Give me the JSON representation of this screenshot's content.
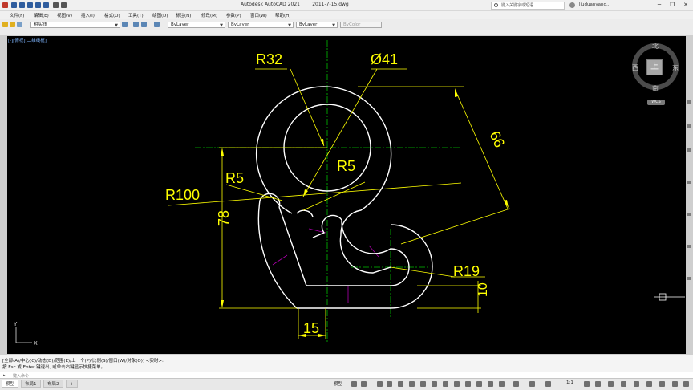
{
  "titlebar": {
    "app_title": "Autodesk AutoCAD 2021",
    "filename": "2011-7-15.dwg",
    "search_placeholder": "键入关键字或短语",
    "user": "liuduanyang...",
    "minimize": "─",
    "restore": "❐",
    "close": "✕"
  },
  "menu": [
    "文件(F)",
    "编辑(E)",
    "视图(V)",
    "插入(I)",
    "格式(O)",
    "工具(T)",
    "绘图(D)",
    "标注(N)",
    "修改(M)",
    "参数(P)",
    "窗口(W)",
    "帮助(H)"
  ],
  "toolbar": {
    "layer": "粗实线",
    "color": "ByLayer",
    "linetype": "ByLayer",
    "lineweight": "ByLayer",
    "plotstyle": "ByColor"
  },
  "viewport": {
    "label": "[-][俯视][二维线框]"
  },
  "dimensions": {
    "r32": "R32",
    "d41": "Ø41",
    "d66": "66",
    "r5_left": "R5",
    "r5_right": "R5",
    "r100": "R100",
    "d78": "78",
    "r19": "R19",
    "d10": "10",
    "d15": "15"
  },
  "ucs": {
    "y": "Y",
    "x": "X"
  },
  "viewcube": {
    "north": "北",
    "south": "南",
    "east": "东",
    "west": "西",
    "face": "上",
    "wcs": "WCS"
  },
  "command": {
    "line1": "[全部(A)/中心(C)/动态(D)/范围(E)/上一个(P)/比例(S)/窗口(W)/对象(O)] <实时>:",
    "line2": "按 Esc 或 Enter 键退出, 或单击右键显示快捷菜单。",
    "placeholder": "键入命令"
  },
  "status": {
    "tabs": [
      "模型",
      "布局1",
      "布局2"
    ],
    "add_tab": "+",
    "model": "模型",
    "scale": "1:1"
  },
  "colors": {
    "geometry": "#ffffff",
    "dimension": "#ffff00",
    "centerline": "#00c000",
    "hidden": "#b000b0",
    "canvas": "#000000"
  }
}
